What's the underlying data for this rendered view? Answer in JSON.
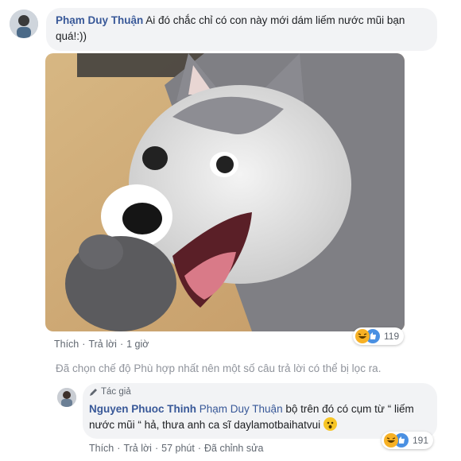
{
  "comment": {
    "author": "Phạm Duy Thuận",
    "text": "Ai đó chắc chỉ có con này mới dám liếm nước mũi bạn quá!:))",
    "actions": {
      "like": "Thích",
      "reply": "Trả lời",
      "time": "1 giờ"
    },
    "reactions": {
      "count": "119",
      "icons": [
        "haha-icon",
        "wow-icon"
      ]
    }
  },
  "filter_note": "Đã chọn chế độ Phù hợp nhất nên một số câu trả lời có thể bị lọc ra.",
  "reply": {
    "author_badge": "Tác giả",
    "author": "Nguyen Phuoc Thinh",
    "mention": "Phạm Duy Thuận",
    "text": "bộ trên đó có cụm từ “ liếm nước mũi “ hả, thưa anh ca sĩ daylamotbaihatvui",
    "actions": {
      "like": "Thích",
      "reply": "Trả lời",
      "time": "57 phút",
      "edited": "Đã chỉnh sửa"
    },
    "reactions": {
      "count": "191",
      "icons": [
        "haha-icon",
        "wow-icon"
      ]
    }
  },
  "colors": {
    "name": "#385898",
    "bubble": "#f2f3f5",
    "meta": "#606770",
    "note": "#90949c"
  }
}
